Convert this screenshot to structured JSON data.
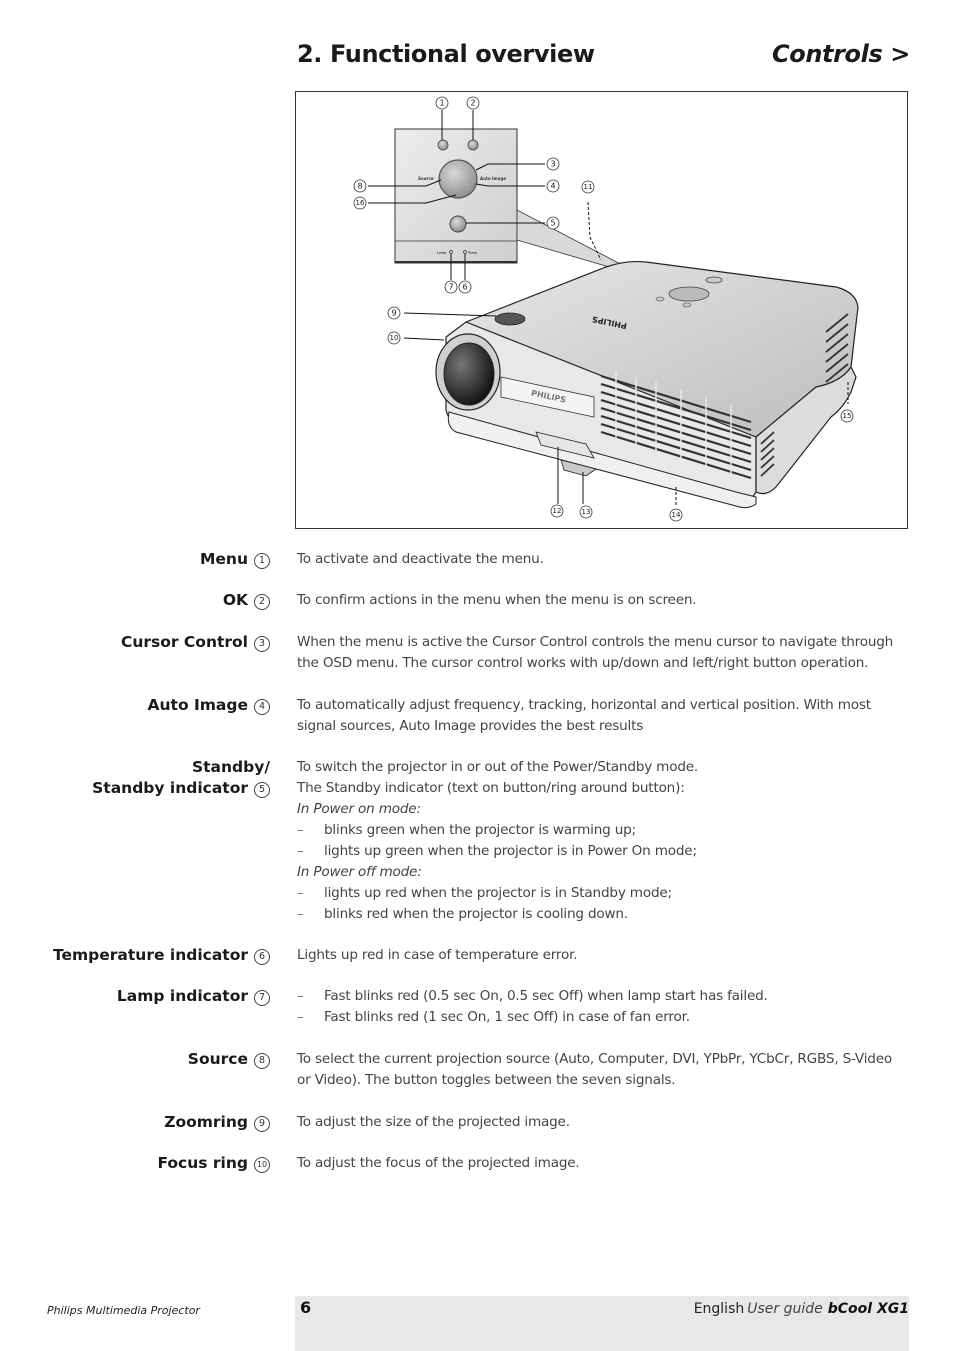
{
  "header": {
    "title": "2. Functional overview",
    "section": "Controls >"
  },
  "figure": {
    "panel_labels": {
      "source": "Source",
      "auto_image": "Auto Image",
      "lamp": "Lamp",
      "temp": "Temp"
    },
    "brand_text": "PHILIPS",
    "callouts": [
      "1",
      "2",
      "3",
      "4",
      "5",
      "6",
      "7",
      "8",
      "9",
      "10",
      "11",
      "12",
      "13",
      "14",
      "15",
      "16"
    ]
  },
  "items": [
    {
      "num": "1",
      "term": "Menu",
      "desc": [
        "To activate and deactivate the menu."
      ]
    },
    {
      "num": "2",
      "term": "OK",
      "desc": [
        "To confirm actions in the menu when the menu is on screen."
      ]
    },
    {
      "num": "3",
      "term": "Cursor Control",
      "desc": [
        "When the menu is active the Cursor Control controls the menu cursor to navigate through the OSD menu. The cursor control works with up/down and left/right button operation."
      ]
    },
    {
      "num": "4",
      "term": "Auto Image",
      "desc": [
        "To automatically adjust frequency, tracking, horizontal and vertical position. With most signal sources, Auto Image provides the best results"
      ]
    },
    {
      "num": "5",
      "term_line1": "Standby/",
      "term": "Standby indicator",
      "desc_lines": [
        {
          "type": "p",
          "text": "To switch the projector in or out of the Power/Standby mode."
        },
        {
          "type": "p",
          "text": "The Standby indicator (text on button/ring around button):"
        },
        {
          "type": "it",
          "text": "In Power on mode:"
        },
        {
          "type": "li",
          "text": "blinks green when the projector is warming up;"
        },
        {
          "type": "li",
          "text": "lights up green when the projector is in Power On mode;"
        },
        {
          "type": "it",
          "text": "In Power off mode:"
        },
        {
          "type": "li",
          "text": "lights up red when the projector is in Standby mode;"
        },
        {
          "type": "li",
          "text": "blinks red when the projector is cooling down."
        }
      ]
    },
    {
      "num": "6",
      "term": "Temperature indicator",
      "desc": [
        "Lights up red in case of temperature error."
      ]
    },
    {
      "num": "7",
      "term": "Lamp indicator",
      "desc_lines": [
        {
          "type": "li",
          "text": "Fast blinks red (0.5 sec On, 0.5 sec Off) when lamp start has failed."
        },
        {
          "type": "li",
          "text": "Fast blinks red (1 sec On, 1 sec Off) in case of fan error."
        }
      ]
    },
    {
      "num": "8",
      "term": "Source",
      "desc": [
        "To select the current projection source (Auto, Computer, DVI, YPbPr, YCbCr, RGBS, S-Video or Video). The button toggles between the seven signals."
      ]
    },
    {
      "num": "9",
      "term": "Zoomring",
      "desc": [
        "To adjust the size of the projected image."
      ]
    },
    {
      "num": "10",
      "term": "Focus ring",
      "desc": [
        "To adjust the focus of the projected image."
      ]
    }
  ],
  "dash": "–",
  "footer": {
    "product": "Philips Multimedia Projector",
    "page": "6",
    "language": "English",
    "doc_type": "User guide",
    "model": "bCool XG1"
  }
}
